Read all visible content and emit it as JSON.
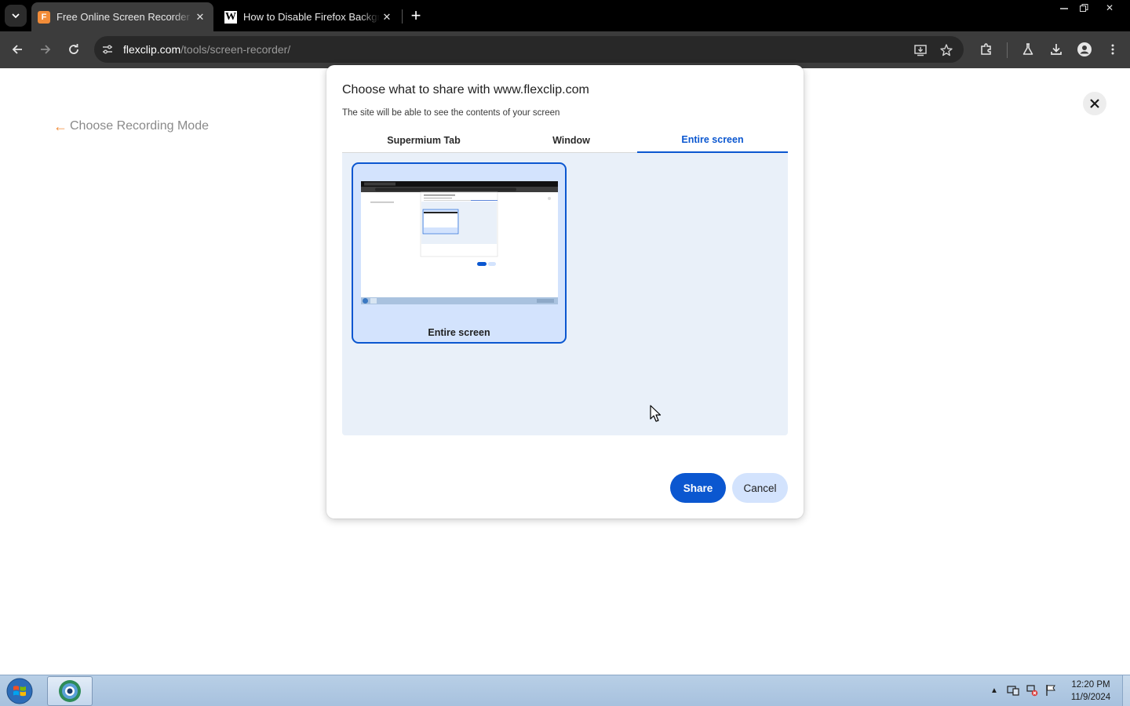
{
  "browser": {
    "tabs": [
      {
        "title": "Free Online Screen Recorder &",
        "favicon": "flexclip-icon",
        "active": true
      },
      {
        "title": "How to Disable Firefox Backgro",
        "favicon": "wikipedia-w-icon",
        "active": false
      }
    ],
    "address_bar": {
      "host": "flexclip.com",
      "path": "/tools/screen-recorder/"
    }
  },
  "page": {
    "back_link_label": "Choose Recording Mode"
  },
  "share_dialog": {
    "title": "Choose what to share with www.flexclip.com",
    "subtitle": "The site will be able to see the contents of your screen",
    "tabs": [
      {
        "label": "Supermium Tab",
        "selected": false
      },
      {
        "label": "Window",
        "selected": false
      },
      {
        "label": "Entire screen",
        "selected": true
      }
    ],
    "sources": [
      {
        "label": "Entire screen",
        "selected": true
      }
    ],
    "share_label": "Share",
    "cancel_label": "Cancel",
    "accent_color": "#0b57d0"
  },
  "taskbar": {
    "clock_time": "12:20 PM",
    "clock_date": "11/9/2024"
  }
}
